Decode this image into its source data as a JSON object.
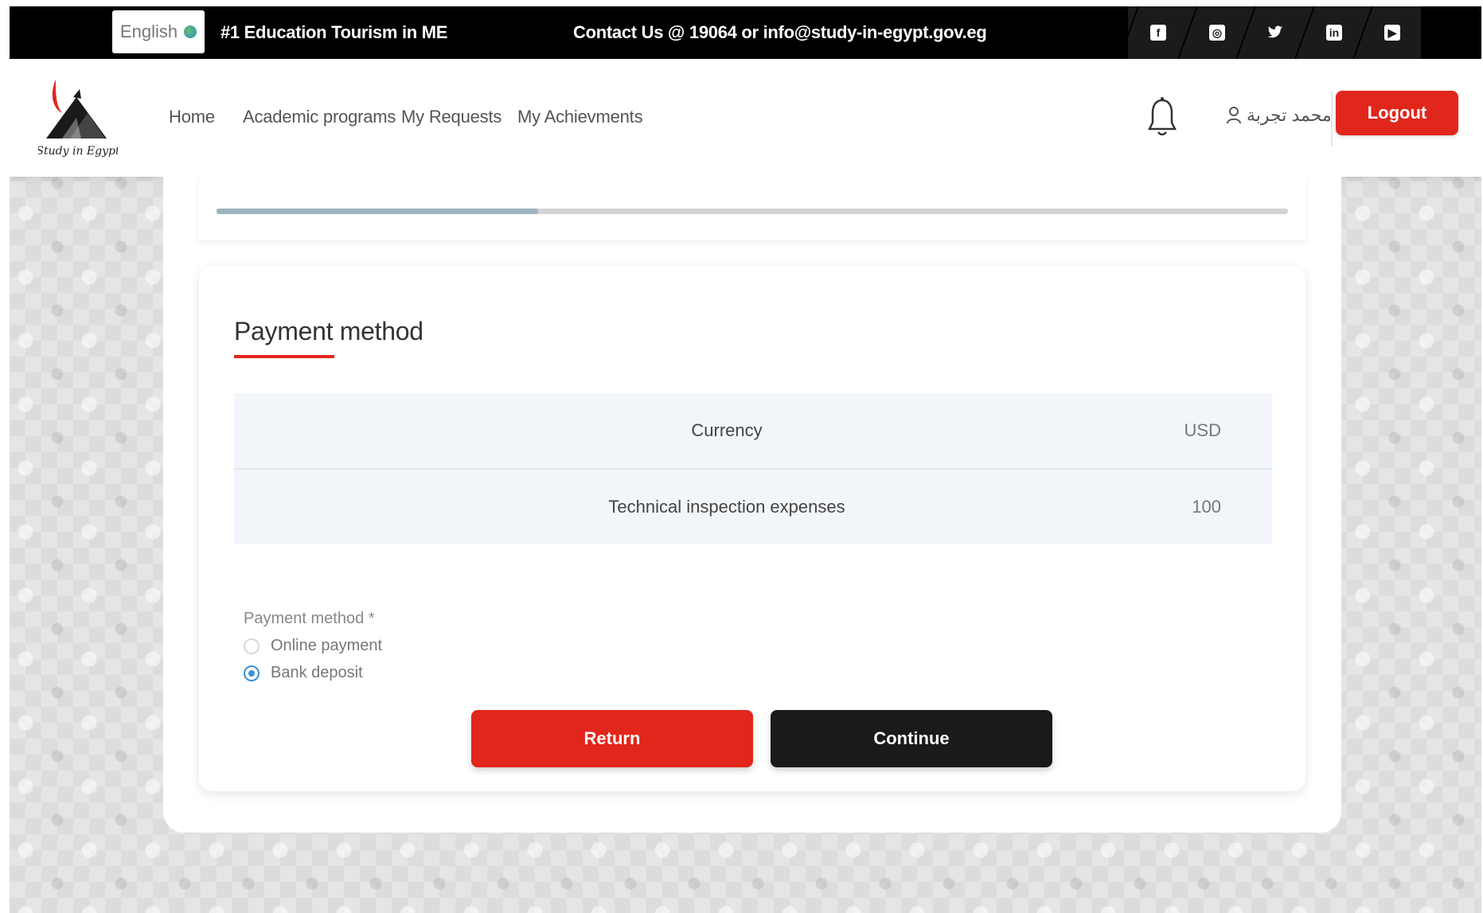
{
  "topbar": {
    "language_label": "English",
    "tagline": "#1 Education Tourism in ME",
    "contact": "Contact Us @ 19064 or info@study-in-egypt.gov.eg",
    "socials": [
      {
        "name": "facebook-icon",
        "glyph": "f"
      },
      {
        "name": "instagram-icon",
        "glyph": "◎"
      },
      {
        "name": "twitter-icon",
        "glyph": "🐦"
      },
      {
        "name": "linkedin-icon",
        "glyph": "in"
      },
      {
        "name": "youtube-icon",
        "glyph": "▶"
      }
    ]
  },
  "navbar": {
    "logo_text": "Study in Egypt",
    "links": [
      "Home",
      "Academic programs",
      "My Requests",
      "My Achievments"
    ],
    "user_name": "محمد تجربة",
    "logout_label": "Logout"
  },
  "steps": {
    "progress": 0.3
  },
  "payment": {
    "title": "Payment method",
    "table": [
      {
        "label": "Currency",
        "value": "USD"
      },
      {
        "label": "Technical inspection expenses",
        "value": "100"
      }
    ],
    "field_label": "Payment method *",
    "options": [
      {
        "label": "Online payment",
        "checked": false
      },
      {
        "label": "Bank deposit",
        "checked": true
      }
    ],
    "return_label": "Return",
    "continue_label": "Continue"
  },
  "colors": {
    "accent_red": "#e1261c",
    "dark_button": "#1a1a1a",
    "radio_blue": "#3b8ed6"
  }
}
